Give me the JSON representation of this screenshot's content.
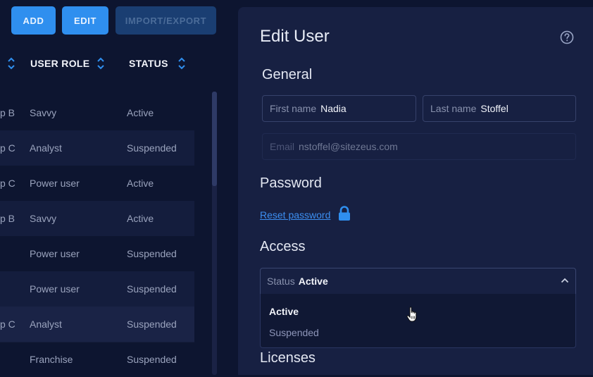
{
  "toolbar": {
    "add_label": "ADD",
    "edit_label": "EDIT",
    "import_export_label": "IMPORT/EXPORT"
  },
  "table": {
    "headers": {
      "user_role": "USER ROLE",
      "status": "STATUS"
    },
    "rows": [
      {
        "group": "p B",
        "role": "Savvy",
        "status": "Active"
      },
      {
        "group": "p C",
        "role": "Analyst",
        "status": "Suspended"
      },
      {
        "group": "p C",
        "role": "Power user",
        "status": "Active"
      },
      {
        "group": "p B",
        "role": "Savvy",
        "status": "Active"
      },
      {
        "group": "",
        "role": "Power user",
        "status": "Suspended"
      },
      {
        "group": "",
        "role": "Power user",
        "status": "Suspended"
      },
      {
        "group": "p C",
        "role": "Analyst",
        "status": "Suspended"
      },
      {
        "group": "",
        "role": "Franchise",
        "status": "Suspended"
      }
    ]
  },
  "edit_user": {
    "title": "Edit User",
    "general": {
      "heading": "General",
      "first_name_label": "First name",
      "first_name_value": "Nadia",
      "last_name_label": "Last name",
      "last_name_value": "Stoffel",
      "email_label": "Email",
      "email_value": "nstoffel@sitezeus.com"
    },
    "password": {
      "heading": "Password",
      "reset_link": "Reset password"
    },
    "access": {
      "heading": "Access",
      "status_label": "Status",
      "status_value": "Active",
      "options": [
        "Active",
        "Suspended"
      ]
    },
    "licenses": {
      "heading": "Licenses"
    }
  },
  "icons": {
    "help": "help-circle-icon",
    "lock": "lock-icon",
    "sort": "sort-icon",
    "chevron": "chevron-up-icon",
    "cursor": "hand-pointer-cursor"
  },
  "colors": {
    "background": "#0d1530",
    "panel": "#172042",
    "accent": "#2f8fef",
    "link": "#3c8ef0"
  }
}
